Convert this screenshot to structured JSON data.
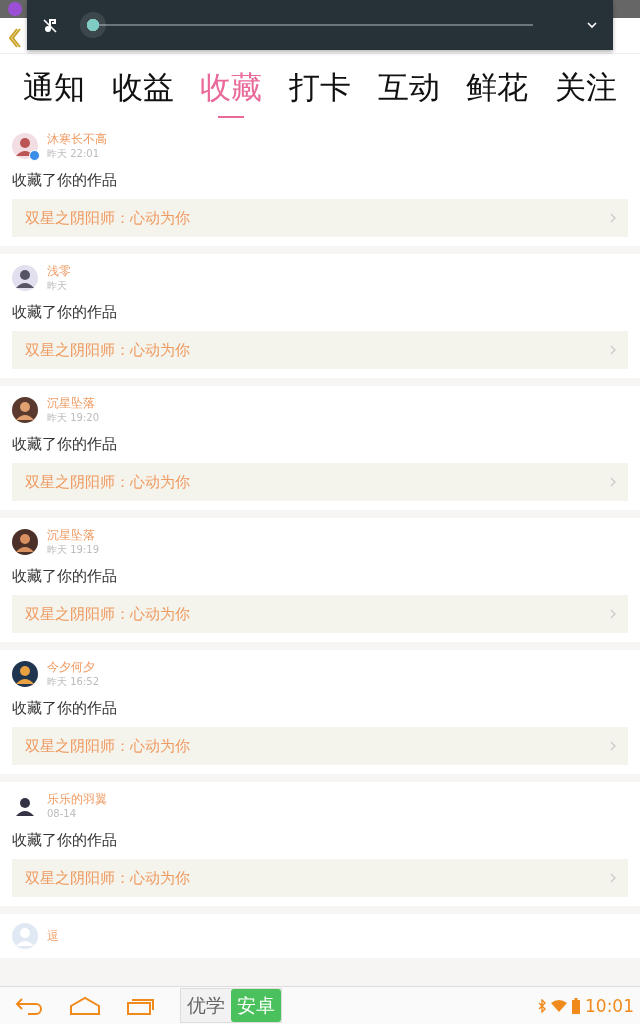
{
  "media_panel": {
    "level": 0
  },
  "tabs": [
    {
      "label": "通知",
      "selected": false
    },
    {
      "label": "收益",
      "selected": false
    },
    {
      "label": "收藏",
      "selected": true
    },
    {
      "label": "打卡",
      "selected": false
    },
    {
      "label": "互动",
      "selected": false
    },
    {
      "label": "鲜花",
      "selected": false
    },
    {
      "label": "关注",
      "selected": false
    }
  ],
  "notifications": [
    {
      "name": "沐寒长不高",
      "verified": true,
      "time": "昨天 22:01",
      "action": "收藏了你的作品",
      "work": "双星之阴阳师：心动为你"
    },
    {
      "name": "浅零",
      "verified": false,
      "time": "昨天",
      "action": "收藏了你的作品",
      "work": "双星之阴阳师：心动为你"
    },
    {
      "name": "沉星坠落",
      "verified": false,
      "time": "昨天 19:20",
      "action": "收藏了你的作品",
      "work": "双星之阴阳师：心动为你"
    },
    {
      "name": "沉星坠落",
      "verified": false,
      "time": "昨天 19:19",
      "action": "收藏了你的作品",
      "work": "双星之阴阳师：心动为你"
    },
    {
      "name": "今夕何夕",
      "verified": false,
      "time": "昨天 16:52",
      "action": "收藏了你的作品",
      "work": "双星之阴阳师：心动为你"
    },
    {
      "name": "乐乐的羽翼",
      "verified": false,
      "time": "08-14",
      "action": "收藏了你的作品",
      "work": "双星之阴阳师：心动为你"
    },
    {
      "name": "逗",
      "verified": false
    }
  ],
  "ime": [
    {
      "label": "优学",
      "selected": false
    },
    {
      "label": "安卓",
      "selected": true
    }
  ],
  "clock": "10:01"
}
